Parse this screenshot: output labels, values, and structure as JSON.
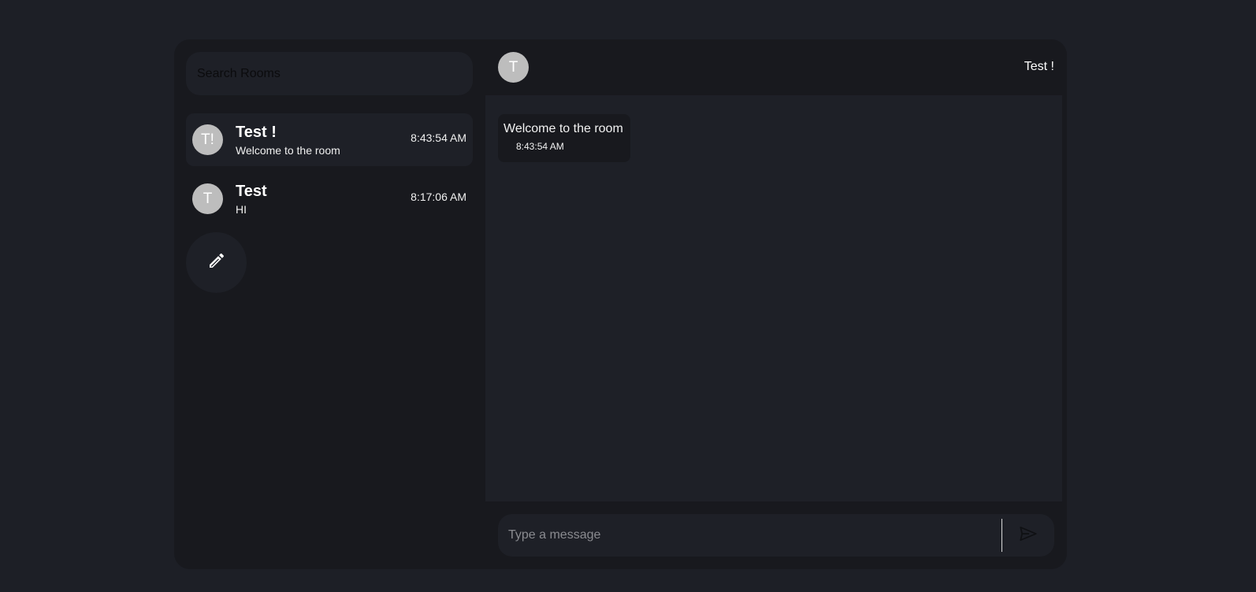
{
  "sidebar": {
    "search_placeholder": "Search Rooms",
    "rooms": [
      {
        "avatar": "T!",
        "name": "Test !",
        "last_message": "Welcome to the room",
        "time": "8:43:54 AM",
        "active": true
      },
      {
        "avatar": "T",
        "name": "Test",
        "last_message": "HI",
        "time": "8:17:06 AM",
        "active": false
      }
    ],
    "compose_icon": "pencil-icon"
  },
  "chat": {
    "header": {
      "avatar": "T",
      "title": "Test !"
    },
    "messages": [
      {
        "text": "Welcome to the room",
        "time": "8:43:54 AM"
      }
    ],
    "input_placeholder": "Type a message",
    "send_icon": "send-icon"
  },
  "colors": {
    "page_background": "#1d1f26",
    "panel_background": "#18191e",
    "surface": "#1e2027",
    "avatar": "#bdbdbd"
  }
}
